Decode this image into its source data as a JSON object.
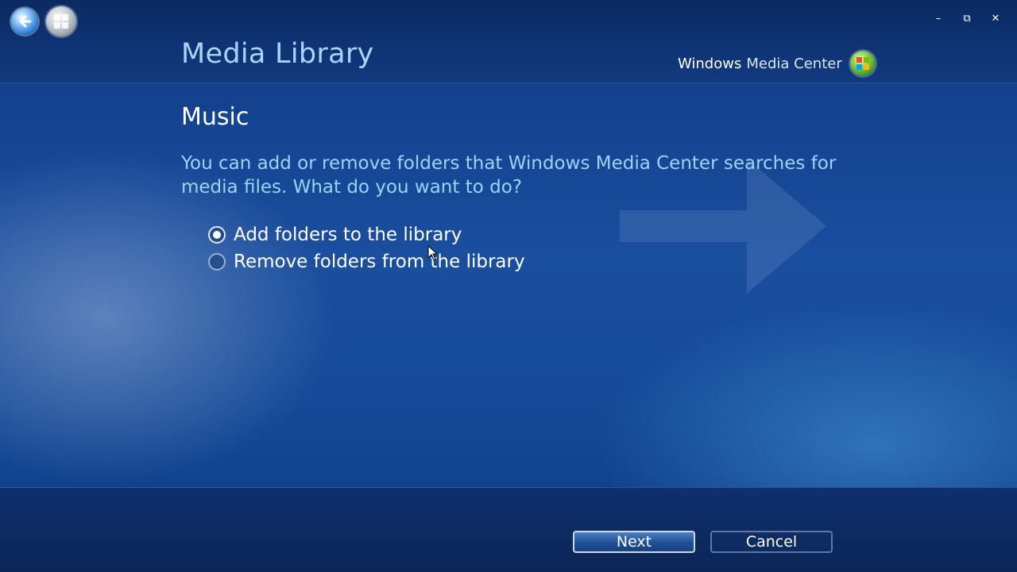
{
  "header": {
    "title": "Media Library",
    "brand_bold": "Windows",
    "brand_light": "Media Center"
  },
  "window_controls": {
    "minimize": "–",
    "restore": "⧉",
    "close": "✕"
  },
  "main": {
    "section_title": "Music",
    "prompt": "You can add or remove folders that Windows Media Center searches for media files. What do you want to do?",
    "options": [
      {
        "label": "Add folders to the library",
        "selected": true
      },
      {
        "label": "Remove folders from the library",
        "selected": false
      }
    ]
  },
  "footer": {
    "next_label": "Next",
    "cancel_label": "Cancel"
  },
  "icons": {
    "back": "back-arrow-icon",
    "start": "windows-start-icon",
    "brand_logo": "windows-flag-icon"
  },
  "colors": {
    "title": "#a9d6ff",
    "prompt": "#9fd2ff",
    "background": "#1a4e9e"
  }
}
